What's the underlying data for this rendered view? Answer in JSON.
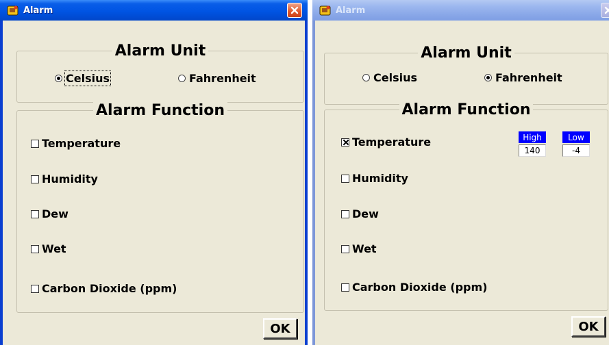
{
  "windows": [
    {
      "title": "Alarm",
      "alarm_unit": {
        "heading": "Alarm Unit",
        "options": [
          {
            "label": "Celsius",
            "selected": true
          },
          {
            "label": "Fahrenheit",
            "selected": false
          }
        ]
      },
      "alarm_function": {
        "heading": "Alarm Function",
        "items": [
          {
            "label": "Temperature",
            "checked": false
          },
          {
            "label": "Humidity",
            "checked": false
          },
          {
            "label": "Dew",
            "checked": false
          },
          {
            "label": "Wet",
            "checked": false
          },
          {
            "label": "Carbon Dioxide (ppm)",
            "checked": false
          }
        ]
      },
      "ok_label": "OK"
    },
    {
      "title": "Alarm",
      "alarm_unit": {
        "heading": "Alarm Unit",
        "options": [
          {
            "label": "Celsius",
            "selected": false
          },
          {
            "label": "Fahrenheit",
            "selected": true
          }
        ]
      },
      "alarm_function": {
        "heading": "Alarm Function",
        "items": [
          {
            "label": "Temperature",
            "checked": true
          },
          {
            "label": "Humidity",
            "checked": false
          },
          {
            "label": "Dew",
            "checked": false
          },
          {
            "label": "Wet",
            "checked": false
          },
          {
            "label": "Carbon Dioxide (ppm)",
            "checked": false
          }
        ],
        "temperature_limits": {
          "high_label": "High",
          "high_value": "140",
          "low_label": "Low",
          "low_value": "-4"
        }
      },
      "ok_label": "OK"
    }
  ],
  "colors": {
    "titlebar_active": "#0054e3",
    "titlebar_inactive": "#8aa8e8",
    "dialog_face": "#ece9d8",
    "limit_label_bg": "#0000ff"
  },
  "icons": [
    "app-icon",
    "close-icon"
  ]
}
